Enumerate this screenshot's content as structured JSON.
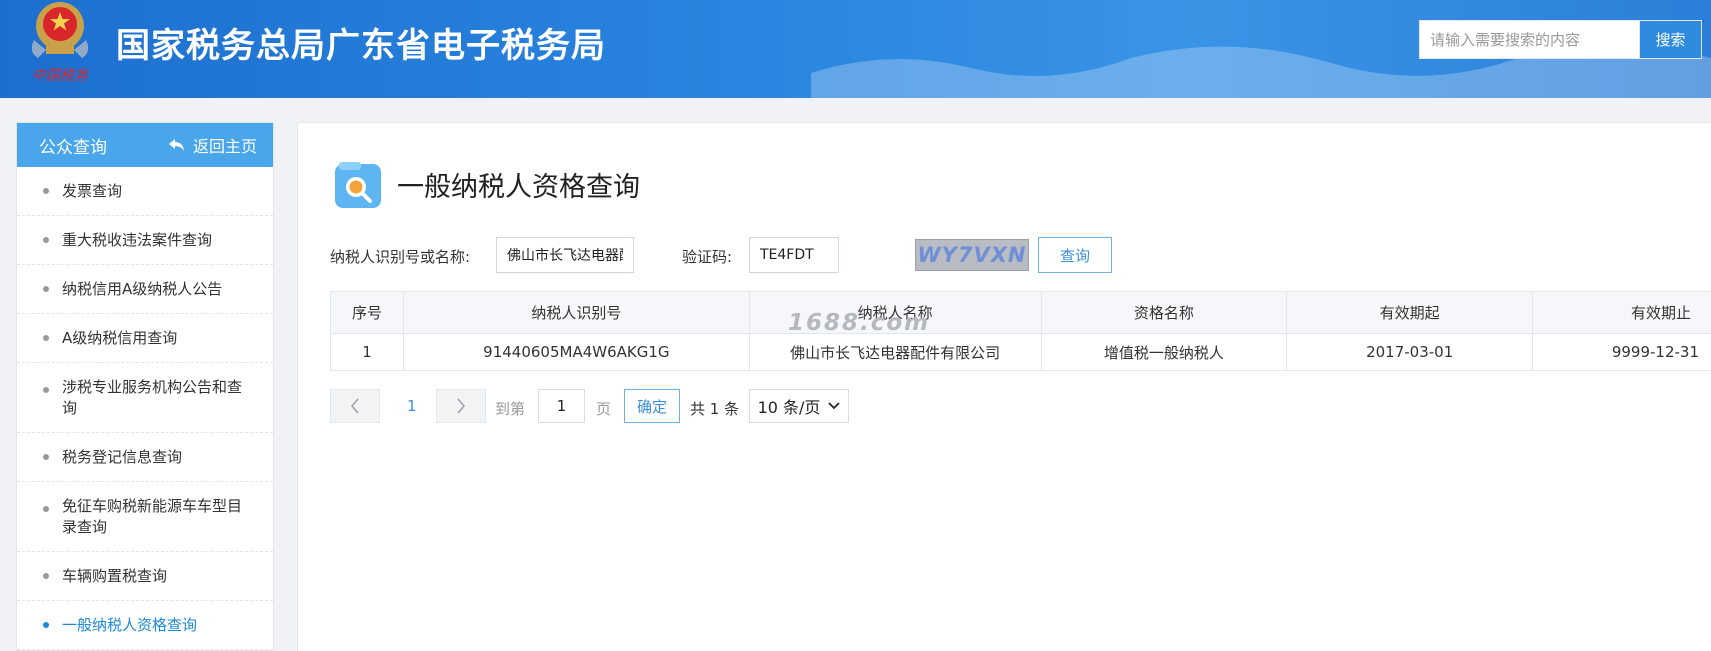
{
  "header": {
    "emblem_caption": "中国税务",
    "site_title": "国家税务总局广东省电子税务局",
    "search_placeholder": "请输入需要搜索的内容",
    "search_button": "搜索"
  },
  "sidebar": {
    "title": "公众查询",
    "back_label": "返回主页",
    "items": [
      {
        "label": "发票查询"
      },
      {
        "label": "重大税收违法案件查询"
      },
      {
        "label": "纳税信用A级纳税人公告"
      },
      {
        "label": "A级纳税信用查询"
      },
      {
        "label": "涉税专业服务机构公告和查询"
      },
      {
        "label": "税务登记信息查询"
      },
      {
        "label": "免征车购税新能源车车型目录查询"
      },
      {
        "label": "车辆购置税查询"
      },
      {
        "label": "一般纳税人资格查询"
      }
    ]
  },
  "main": {
    "page_title": "一般纳税人资格查询",
    "form": {
      "taxpayer_label": "纳税人识别号或名称:",
      "taxpayer_value": "佛山市长飞达电器配件有",
      "captcha_label": "验证码:",
      "captcha_value": "TE4FDT",
      "captcha_image_text": "WY7VXN",
      "query_button": "查询"
    },
    "table": {
      "headers": [
        "序号",
        "纳税人识别号",
        "纳税人名称",
        "资格名称",
        "有效期起",
        "有效期止"
      ],
      "rows": [
        [
          "1",
          "91440605MA4W6AKG1G",
          "佛山市长飞达电器配件有限公司",
          "增值税一般纳税人",
          "2017-03-01",
          "9999-12-31"
        ]
      ]
    },
    "watermark": "1688.com",
    "pager": {
      "current_page": "1",
      "goto_prefix": "到第",
      "goto_value": "1",
      "goto_suffix": "页",
      "confirm": "确定",
      "total": "共 1 条",
      "page_size": "10 条/页"
    }
  },
  "colors": {
    "header_blue": "#2a86e0",
    "sidebar_head": "#4aa6ea",
    "active_link": "#1c88d6",
    "accent": "#3a8fd6"
  }
}
